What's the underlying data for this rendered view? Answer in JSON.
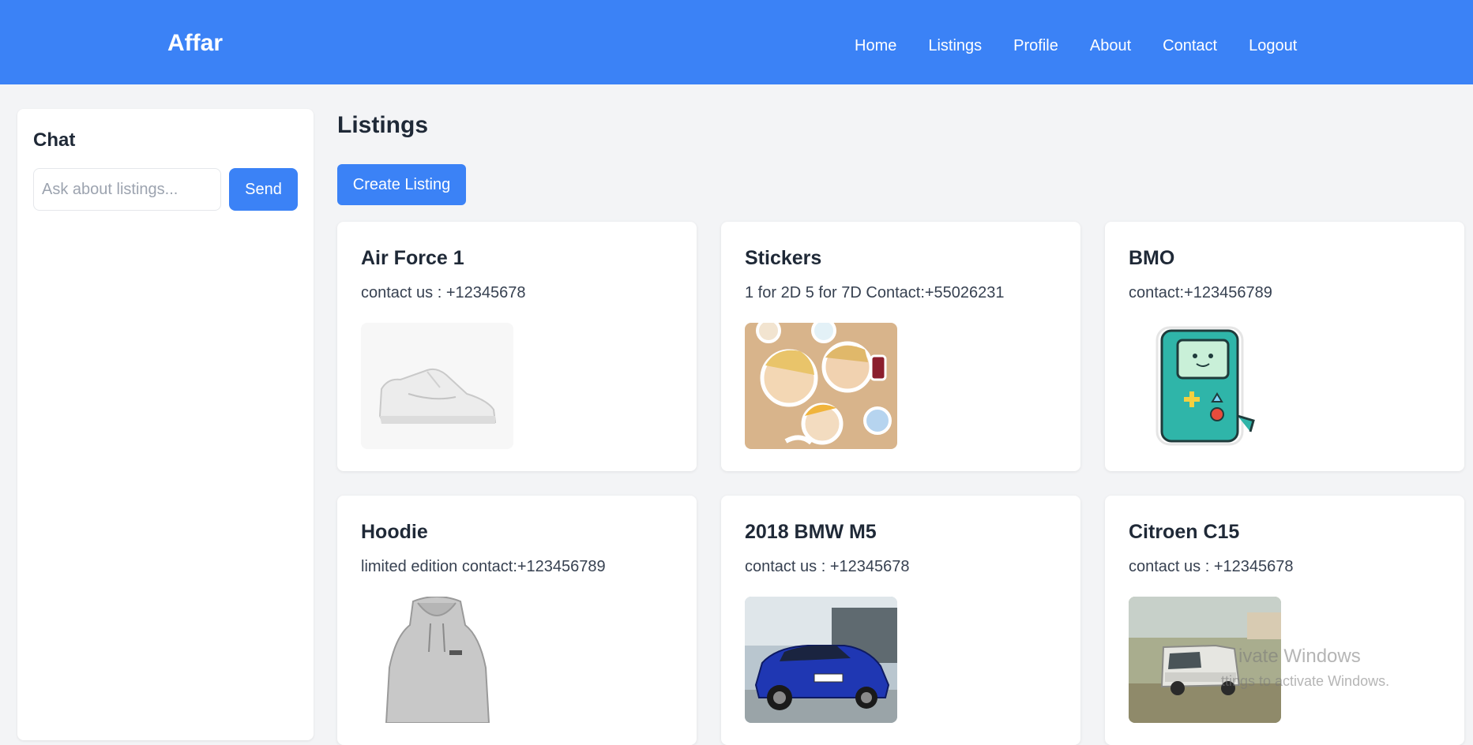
{
  "navbar": {
    "brand": "Affar",
    "links": [
      "Home",
      "Listings",
      "Profile",
      "About",
      "Contact",
      "Logout"
    ],
    "bg_color": "#3b82f6"
  },
  "chat": {
    "title": "Chat",
    "input_placeholder": "Ask about listings...",
    "input_value": "",
    "send_label": "Send"
  },
  "main": {
    "title": "Listings",
    "create_label": "Create Listing"
  },
  "listings": [
    {
      "title": "Air Force 1",
      "description": "contact us : +12345678",
      "image": "white-sneaker-photo"
    },
    {
      "title": "Stickers",
      "description": "1 for 2D 5 for 7D Contact:+55026231",
      "image": "anime-stickers-photo"
    },
    {
      "title": "BMO",
      "description": "contact:+123456789",
      "image": "bmo-sticker-photo"
    },
    {
      "title": "Hoodie",
      "description": "limited edition contact:+123456789",
      "image": "grey-hoodie-photo"
    },
    {
      "title": "2018 BMW M5",
      "description": "contact us : +12345678",
      "image": "blue-bmw-photo"
    },
    {
      "title": "Citroen C15",
      "description": "contact us : +12345678",
      "image": "white-van-photo"
    }
  ],
  "watermark": {
    "title": "ivate Windows",
    "subtitle": "ttings to activate Windows."
  },
  "colors": {
    "accent": "#3b82f6",
    "page_bg": "#f3f4f6",
    "card_bg": "#ffffff"
  }
}
